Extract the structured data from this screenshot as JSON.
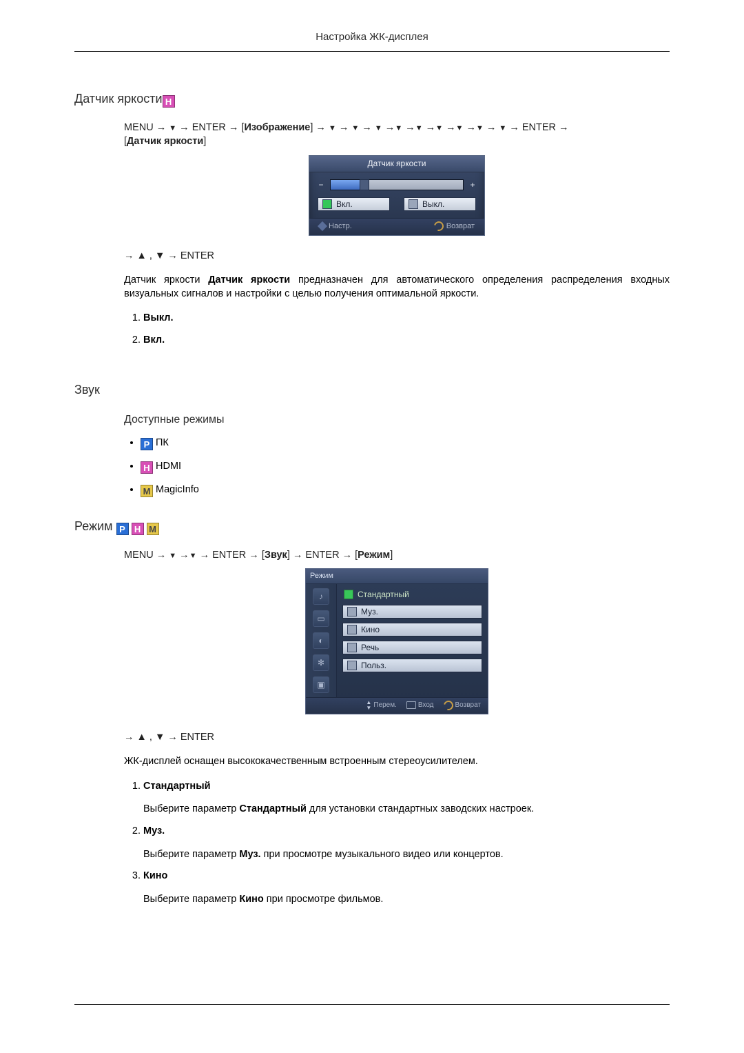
{
  "header": {
    "title": "Настройка ЖК-дисплея"
  },
  "sensor": {
    "title": "Датчик яркости",
    "nav1_pre": "MENU → ",
    "nav1_enter1": " → ENTER → [",
    "nav1_image": "Изображение",
    "nav1_mid": "] → ",
    "nav1_enter2": " → ENTER → ",
    "nav1_open": "[",
    "nav1_label": "Датчик яркости",
    "nav1_close": "]",
    "osd": {
      "title": "Датчик яркости",
      "on": "Вкл.",
      "off": "Выкл.",
      "adjust": "Настр.",
      "back": "Возврат",
      "fill_pct": 22
    },
    "nav2": "→ ▲ , ▼ → ENTER",
    "para_a": "Датчик яркости ",
    "para_b": "Датчик яркости",
    "para_c": " предназначен для автоматического определения распределения входных визуальных сигналов и настройки с целью получения оптимальной яркости.",
    "list": [
      "Выкл.",
      "Вкл."
    ]
  },
  "sound": {
    "title": "Звук",
    "modes_title": "Доступные режимы",
    "modes": [
      {
        "icon": "P",
        "label": "ПК"
      },
      {
        "icon": "H",
        "label": "HDMI"
      },
      {
        "icon": "M",
        "label": "MagicInfo"
      }
    ]
  },
  "mode": {
    "title": "Режим",
    "nav": {
      "pre": "MENU → ",
      "enter1": " → ENTER → [",
      "sound": "Звук",
      "mid": "] → ENTER → [",
      "mode": "Режим",
      "end": "]"
    },
    "osd": {
      "title": "Режим",
      "items": [
        "Стандартный",
        "Муз.",
        "Кино",
        "Речь",
        "Польз."
      ],
      "move": "Перем.",
      "enter": "Вход",
      "back": "Возврат"
    },
    "nav2": "→ ▲ , ▼ → ENTER",
    "para": "ЖК-дисплей оснащен высококачественным встроенным стереоусилителем.",
    "items": [
      {
        "head": "Стандартный",
        "body_a": "Выберите параметр ",
        "body_b": "Стандартный",
        "body_c": " для установки стандартных заводских настроек."
      },
      {
        "head": "Муз.",
        "body_a": "Выберите параметр ",
        "body_b": "Муз.",
        "body_c": " при просмотре музыкального видео или концертов."
      },
      {
        "head": "Кино",
        "body_a": "Выберите параметр ",
        "body_b": "Кино",
        "body_c": " при просмотре фильмов."
      }
    ]
  }
}
